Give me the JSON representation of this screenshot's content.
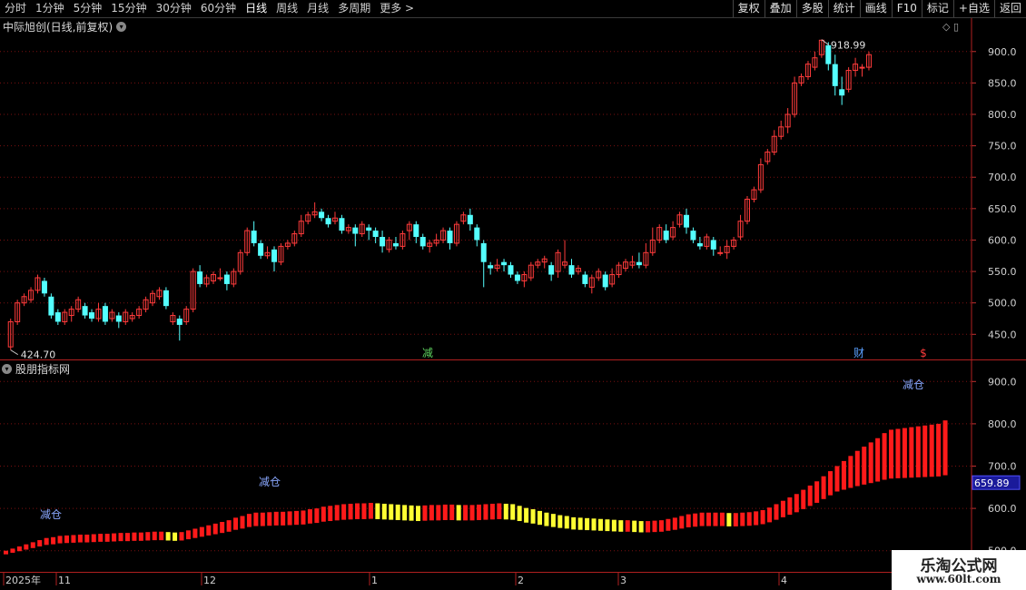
{
  "toolbar": {
    "periods": [
      "分时",
      "1分钟",
      "5分钟",
      "15分钟",
      "30分钟",
      "60分钟",
      "日线",
      "周线",
      "月线",
      "多周期",
      "更多 >"
    ],
    "active_period": "日线",
    "right_buttons": [
      "复权",
      "叠加",
      "多股",
      "统计",
      "画线",
      "F10",
      "标记",
      "+自选",
      "返回"
    ]
  },
  "main_panel": {
    "title": "中际旭创(日线,前复权)",
    "high_label": "918.99",
    "low_label": "424.70",
    "y_ticks": [
      "900.0",
      "850.0",
      "800.0",
      "750.0",
      "700.0",
      "650.0",
      "600.0",
      "550.0",
      "500.0",
      "450.0"
    ],
    "markers": [
      {
        "text": "减",
        "color": "#5fd35f"
      },
      {
        "text": "财",
        "color": "#5aa0ff"
      },
      {
        "text": "$",
        "color": "#ff3b3b"
      }
    ]
  },
  "indicator_panel": {
    "title": "股朋指标网",
    "y_ticks": [
      "900.0",
      "800.0",
      "700.0",
      "600.0",
      "500.0"
    ],
    "current_value": "659.89",
    "annotations": [
      "减仓",
      "减仓",
      "减仓"
    ]
  },
  "x_axis": {
    "labels": [
      "2025年",
      "11",
      "12",
      "1",
      "2",
      "3",
      "4"
    ]
  },
  "watermark": {
    "line1": "乐淘公式网",
    "line2": "www.60lt.com"
  },
  "colors": {
    "up": "#ff3b3b",
    "down": "#54ffff",
    "indicator_rise": "#ff1a1a",
    "indicator_fall": "#ffff33",
    "grid": "#7a1010"
  },
  "chart_data": {
    "type": "candlestick",
    "series": [
      {
        "name": "中际旭创",
        "values": [
          [
            430,
            470,
            425,
            475
          ],
          [
            470,
            500,
            465,
            505
          ],
          [
            500,
            510,
            495,
            515
          ],
          [
            505,
            520,
            500,
            525
          ],
          [
            520,
            540,
            515,
            545
          ],
          [
            535,
            515,
            510,
            540
          ],
          [
            510,
            480,
            475,
            515
          ],
          [
            485,
            470,
            465,
            490
          ],
          [
            470,
            485,
            465,
            490
          ],
          [
            480,
            490,
            470,
            495
          ],
          [
            490,
            505,
            485,
            510
          ],
          [
            495,
            480,
            475,
            500
          ],
          [
            485,
            475,
            470,
            490
          ],
          [
            475,
            490,
            470,
            500
          ],
          [
            495,
            470,
            465,
            500
          ],
          [
            475,
            485,
            470,
            490
          ],
          [
            480,
            470,
            460,
            485
          ],
          [
            470,
            485,
            465,
            490
          ],
          [
            475,
            480,
            470,
            485
          ],
          [
            480,
            490,
            475,
            495
          ],
          [
            490,
            505,
            485,
            510
          ],
          [
            500,
            515,
            495,
            520
          ],
          [
            510,
            520,
            505,
            525
          ],
          [
            520,
            495,
            490,
            525
          ],
          [
            470,
            480,
            465,
            485
          ],
          [
            475,
            465,
            440,
            480
          ],
          [
            470,
            490,
            465,
            495
          ],
          [
            490,
            550,
            485,
            555
          ],
          [
            550,
            530,
            525,
            560
          ],
          [
            530,
            540,
            525,
            545
          ],
          [
            535,
            545,
            530,
            550
          ],
          [
            540,
            540,
            535,
            555
          ],
          [
            545,
            530,
            520,
            550
          ],
          [
            530,
            550,
            525,
            555
          ],
          [
            550,
            580,
            545,
            585
          ],
          [
            580,
            615,
            575,
            620
          ],
          [
            615,
            595,
            590,
            630
          ],
          [
            595,
            575,
            570,
            600
          ],
          [
            575,
            580,
            570,
            590
          ],
          [
            585,
            565,
            550,
            590
          ],
          [
            565,
            590,
            560,
            595
          ],
          [
            590,
            595,
            585,
            600
          ],
          [
            595,
            610,
            590,
            615
          ],
          [
            610,
            630,
            605,
            640
          ],
          [
            630,
            640,
            625,
            645
          ],
          [
            640,
            645,
            635,
            660
          ],
          [
            645,
            635,
            630,
            650
          ],
          [
            635,
            625,
            620,
            640
          ],
          [
            630,
            635,
            625,
            645
          ],
          [
            635,
            615,
            610,
            640
          ],
          [
            615,
            620,
            610,
            625
          ],
          [
            620,
            610,
            590,
            625
          ],
          [
            610,
            625,
            605,
            630
          ],
          [
            620,
            615,
            600,
            625
          ],
          [
            615,
            605,
            595,
            620
          ],
          [
            605,
            590,
            580,
            615
          ],
          [
            585,
            600,
            580,
            605
          ],
          [
            595,
            590,
            585,
            605
          ],
          [
            590,
            610,
            585,
            615
          ],
          [
            615,
            625,
            600,
            630
          ],
          [
            625,
            605,
            595,
            630
          ],
          [
            605,
            590,
            585,
            610
          ],
          [
            590,
            595,
            580,
            600
          ],
          [
            595,
            600,
            590,
            610
          ],
          [
            600,
            615,
            595,
            620
          ],
          [
            615,
            595,
            585,
            620
          ],
          [
            595,
            625,
            590,
            630
          ],
          [
            630,
            640,
            625,
            645
          ],
          [
            640,
            625,
            615,
            650
          ],
          [
            620,
            600,
            590,
            625
          ],
          [
            595,
            565,
            525,
            600
          ],
          [
            560,
            555,
            545,
            565
          ],
          [
            555,
            560,
            550,
            570
          ],
          [
            565,
            560,
            550,
            570
          ],
          [
            560,
            545,
            540,
            565
          ],
          [
            545,
            535,
            530,
            550
          ],
          [
            535,
            545,
            525,
            550
          ],
          [
            540,
            560,
            535,
            565
          ],
          [
            560,
            565,
            555,
            570
          ],
          [
            565,
            570,
            555,
            575
          ],
          [
            560,
            545,
            535,
            565
          ],
          [
            550,
            580,
            540,
            585
          ],
          [
            560,
            565,
            555,
            600
          ],
          [
            560,
            545,
            540,
            570
          ],
          [
            550,
            555,
            545,
            560
          ],
          [
            545,
            530,
            525,
            550
          ],
          [
            525,
            540,
            515,
            545
          ],
          [
            540,
            550,
            535,
            555
          ],
          [
            545,
            525,
            520,
            550
          ],
          [
            530,
            545,
            525,
            555
          ],
          [
            545,
            560,
            540,
            565
          ],
          [
            555,
            565,
            550,
            570
          ],
          [
            560,
            565,
            555,
            575
          ],
          [
            565,
            560,
            555,
            580
          ],
          [
            560,
            580,
            555,
            595
          ],
          [
            580,
            600,
            575,
            620
          ],
          [
            600,
            620,
            595,
            625
          ],
          [
            615,
            600,
            595,
            625
          ],
          [
            605,
            620,
            600,
            630
          ],
          [
            625,
            640,
            620,
            645
          ],
          [
            640,
            620,
            610,
            650
          ],
          [
            615,
            600,
            595,
            620
          ],
          [
            595,
            590,
            585,
            605
          ],
          [
            590,
            605,
            585,
            610
          ],
          [
            600,
            585,
            575,
            605
          ],
          [
            580,
            580,
            575,
            590
          ],
          [
            580,
            590,
            570,
            600
          ],
          [
            590,
            600,
            585,
            605
          ],
          [
            605,
            630,
            600,
            640
          ],
          [
            630,
            665,
            625,
            670
          ],
          [
            665,
            680,
            660,
            685
          ],
          [
            680,
            720,
            675,
            730
          ],
          [
            725,
            740,
            720,
            745
          ],
          [
            740,
            765,
            735,
            775
          ],
          [
            765,
            780,
            760,
            790
          ],
          [
            780,
            800,
            770,
            810
          ],
          [
            800,
            850,
            795,
            860
          ],
          [
            850,
            860,
            845,
            865
          ],
          [
            860,
            880,
            855,
            885
          ],
          [
            875,
            890,
            870,
            900
          ],
          [
            895,
            918,
            890,
            919
          ],
          [
            910,
            880,
            870,
            915
          ],
          [
            880,
            845,
            830,
            895
          ],
          [
            840,
            830,
            815,
            860
          ],
          [
            840,
            870,
            835,
            875
          ],
          [
            870,
            880,
            860,
            890
          ],
          [
            875,
            875,
            860,
            880
          ],
          [
            875,
            895,
            870,
            900
          ]
        ]
      }
    ],
    "indicator": {
      "values": [
        500,
        505,
        510,
        515,
        520,
        525,
        530,
        532,
        535,
        536,
        537,
        538,
        538,
        539,
        540,
        540,
        541,
        542,
        542,
        543,
        543,
        544,
        545,
        545,
        544,
        543,
        544,
        548,
        552,
        556,
        560,
        564,
        568,
        572,
        578,
        582,
        587,
        590,
        590,
        591,
        592,
        592,
        593,
        594,
        595,
        598,
        600,
        604,
        606,
        608,
        610,
        611,
        612,
        612,
        613,
        612,
        611,
        610,
        609,
        608,
        607,
        606,
        607,
        608,
        608,
        609,
        609,
        608,
        608,
        608,
        609,
        610,
        611,
        612,
        611,
        610,
        606,
        601,
        598,
        594,
        590,
        587,
        584,
        582,
        579,
        578,
        577,
        576,
        575,
        574,
        573,
        572,
        572,
        571,
        570,
        570,
        571,
        572,
        575,
        578,
        582,
        586,
        588,
        590,
        590,
        590,
        590,
        589,
        589,
        590,
        591,
        593,
        596,
        602,
        610,
        618,
        626,
        634,
        644,
        654,
        664,
        676,
        688,
        700,
        712,
        724,
        736,
        746,
        756,
        766,
        778,
        786,
        788,
        790,
        792,
        794,
        796,
        798,
        800,
        808
      ],
      "ylim": [
        450,
        950
      ]
    },
    "xlim": [
      0,
      140
    ],
    "ylim": [
      410,
      930
    ]
  }
}
